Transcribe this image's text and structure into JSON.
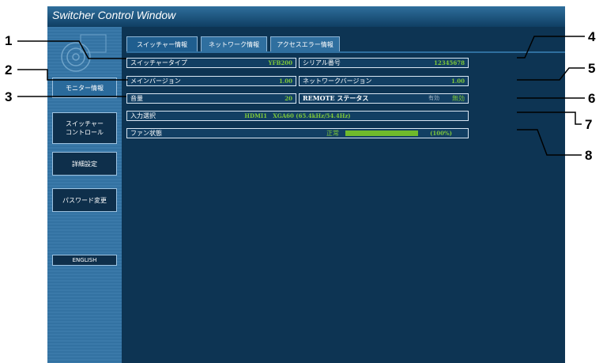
{
  "window": {
    "title": "Switcher Control Window"
  },
  "sidebar": {
    "items": [
      {
        "label": "モニター情報"
      },
      {
        "label": "スイッチャー\nコントロール"
      },
      {
        "label": "詳細設定"
      },
      {
        "label": "パスワード変更"
      },
      {
        "label": "ENGLISH"
      }
    ]
  },
  "tabs": [
    {
      "label": "スイッチャー情報"
    },
    {
      "label": "ネットワーク情報"
    },
    {
      "label": "アクセスエラー情報"
    }
  ],
  "info": {
    "switcher_type": {
      "label": "スイッチャータイプ",
      "value": "YFB200"
    },
    "main_version": {
      "label": "メインバージョン",
      "value": "1.00"
    },
    "volume": {
      "label": "音量",
      "value": "20"
    },
    "serial": {
      "label": "シリアル番号",
      "value": "12345678"
    },
    "network_version": {
      "label": "ネットワークバージョン",
      "value": "1.00"
    },
    "remote": {
      "label": "REMOTE ステータス",
      "enabled": "有効",
      "disabled": "無効"
    },
    "input": {
      "label": "入力選択",
      "value": "HDMI1   XGA60 (65.4kHz/54.4Hz)"
    },
    "fan": {
      "label": "ファン状態",
      "status": "正常",
      "percent": "(100%)",
      "level": 1.0
    }
  },
  "callouts": [
    "1",
    "2",
    "3",
    "4",
    "5",
    "6",
    "7",
    "8"
  ],
  "colors": {
    "window_bg": "#0d3453",
    "sidebar": "#3a79a9",
    "value_green": "#7ec83a"
  }
}
